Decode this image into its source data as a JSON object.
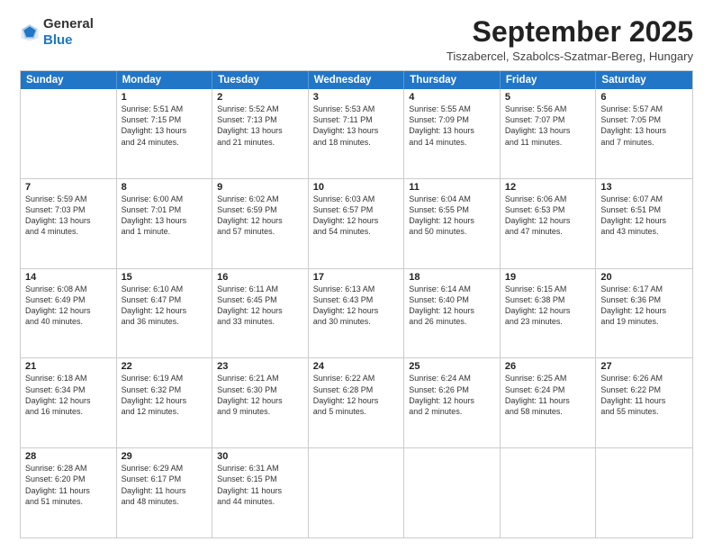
{
  "logo": {
    "general": "General",
    "blue": "Blue"
  },
  "header": {
    "month_title": "September 2025",
    "location": "Tiszabercel, Szabolcs-Szatmar-Bereg, Hungary"
  },
  "weekdays": [
    "Sunday",
    "Monday",
    "Tuesday",
    "Wednesday",
    "Thursday",
    "Friday",
    "Saturday"
  ],
  "rows": [
    [
      {
        "day": "",
        "lines": []
      },
      {
        "day": "1",
        "lines": [
          "Sunrise: 5:51 AM",
          "Sunset: 7:15 PM",
          "Daylight: 13 hours",
          "and 24 minutes."
        ]
      },
      {
        "day": "2",
        "lines": [
          "Sunrise: 5:52 AM",
          "Sunset: 7:13 PM",
          "Daylight: 13 hours",
          "and 21 minutes."
        ]
      },
      {
        "day": "3",
        "lines": [
          "Sunrise: 5:53 AM",
          "Sunset: 7:11 PM",
          "Daylight: 13 hours",
          "and 18 minutes."
        ]
      },
      {
        "day": "4",
        "lines": [
          "Sunrise: 5:55 AM",
          "Sunset: 7:09 PM",
          "Daylight: 13 hours",
          "and 14 minutes."
        ]
      },
      {
        "day": "5",
        "lines": [
          "Sunrise: 5:56 AM",
          "Sunset: 7:07 PM",
          "Daylight: 13 hours",
          "and 11 minutes."
        ]
      },
      {
        "day": "6",
        "lines": [
          "Sunrise: 5:57 AM",
          "Sunset: 7:05 PM",
          "Daylight: 13 hours",
          "and 7 minutes."
        ]
      }
    ],
    [
      {
        "day": "7",
        "lines": [
          "Sunrise: 5:59 AM",
          "Sunset: 7:03 PM",
          "Daylight: 13 hours",
          "and 4 minutes."
        ]
      },
      {
        "day": "8",
        "lines": [
          "Sunrise: 6:00 AM",
          "Sunset: 7:01 PM",
          "Daylight: 13 hours",
          "and 1 minute."
        ]
      },
      {
        "day": "9",
        "lines": [
          "Sunrise: 6:02 AM",
          "Sunset: 6:59 PM",
          "Daylight: 12 hours",
          "and 57 minutes."
        ]
      },
      {
        "day": "10",
        "lines": [
          "Sunrise: 6:03 AM",
          "Sunset: 6:57 PM",
          "Daylight: 12 hours",
          "and 54 minutes."
        ]
      },
      {
        "day": "11",
        "lines": [
          "Sunrise: 6:04 AM",
          "Sunset: 6:55 PM",
          "Daylight: 12 hours",
          "and 50 minutes."
        ]
      },
      {
        "day": "12",
        "lines": [
          "Sunrise: 6:06 AM",
          "Sunset: 6:53 PM",
          "Daylight: 12 hours",
          "and 47 minutes."
        ]
      },
      {
        "day": "13",
        "lines": [
          "Sunrise: 6:07 AM",
          "Sunset: 6:51 PM",
          "Daylight: 12 hours",
          "and 43 minutes."
        ]
      }
    ],
    [
      {
        "day": "14",
        "lines": [
          "Sunrise: 6:08 AM",
          "Sunset: 6:49 PM",
          "Daylight: 12 hours",
          "and 40 minutes."
        ]
      },
      {
        "day": "15",
        "lines": [
          "Sunrise: 6:10 AM",
          "Sunset: 6:47 PM",
          "Daylight: 12 hours",
          "and 36 minutes."
        ]
      },
      {
        "day": "16",
        "lines": [
          "Sunrise: 6:11 AM",
          "Sunset: 6:45 PM",
          "Daylight: 12 hours",
          "and 33 minutes."
        ]
      },
      {
        "day": "17",
        "lines": [
          "Sunrise: 6:13 AM",
          "Sunset: 6:43 PM",
          "Daylight: 12 hours",
          "and 30 minutes."
        ]
      },
      {
        "day": "18",
        "lines": [
          "Sunrise: 6:14 AM",
          "Sunset: 6:40 PM",
          "Daylight: 12 hours",
          "and 26 minutes."
        ]
      },
      {
        "day": "19",
        "lines": [
          "Sunrise: 6:15 AM",
          "Sunset: 6:38 PM",
          "Daylight: 12 hours",
          "and 23 minutes."
        ]
      },
      {
        "day": "20",
        "lines": [
          "Sunrise: 6:17 AM",
          "Sunset: 6:36 PM",
          "Daylight: 12 hours",
          "and 19 minutes."
        ]
      }
    ],
    [
      {
        "day": "21",
        "lines": [
          "Sunrise: 6:18 AM",
          "Sunset: 6:34 PM",
          "Daylight: 12 hours",
          "and 16 minutes."
        ]
      },
      {
        "day": "22",
        "lines": [
          "Sunrise: 6:19 AM",
          "Sunset: 6:32 PM",
          "Daylight: 12 hours",
          "and 12 minutes."
        ]
      },
      {
        "day": "23",
        "lines": [
          "Sunrise: 6:21 AM",
          "Sunset: 6:30 PM",
          "Daylight: 12 hours",
          "and 9 minutes."
        ]
      },
      {
        "day": "24",
        "lines": [
          "Sunrise: 6:22 AM",
          "Sunset: 6:28 PM",
          "Daylight: 12 hours",
          "and 5 minutes."
        ]
      },
      {
        "day": "25",
        "lines": [
          "Sunrise: 6:24 AM",
          "Sunset: 6:26 PM",
          "Daylight: 12 hours",
          "and 2 minutes."
        ]
      },
      {
        "day": "26",
        "lines": [
          "Sunrise: 6:25 AM",
          "Sunset: 6:24 PM",
          "Daylight: 11 hours",
          "and 58 minutes."
        ]
      },
      {
        "day": "27",
        "lines": [
          "Sunrise: 6:26 AM",
          "Sunset: 6:22 PM",
          "Daylight: 11 hours",
          "and 55 minutes."
        ]
      }
    ],
    [
      {
        "day": "28",
        "lines": [
          "Sunrise: 6:28 AM",
          "Sunset: 6:20 PM",
          "Daylight: 11 hours",
          "and 51 minutes."
        ]
      },
      {
        "day": "29",
        "lines": [
          "Sunrise: 6:29 AM",
          "Sunset: 6:17 PM",
          "Daylight: 11 hours",
          "and 48 minutes."
        ]
      },
      {
        "day": "30",
        "lines": [
          "Sunrise: 6:31 AM",
          "Sunset: 6:15 PM",
          "Daylight: 11 hours",
          "and 44 minutes."
        ]
      },
      {
        "day": "",
        "lines": []
      },
      {
        "day": "",
        "lines": []
      },
      {
        "day": "",
        "lines": []
      },
      {
        "day": "",
        "lines": []
      }
    ]
  ]
}
